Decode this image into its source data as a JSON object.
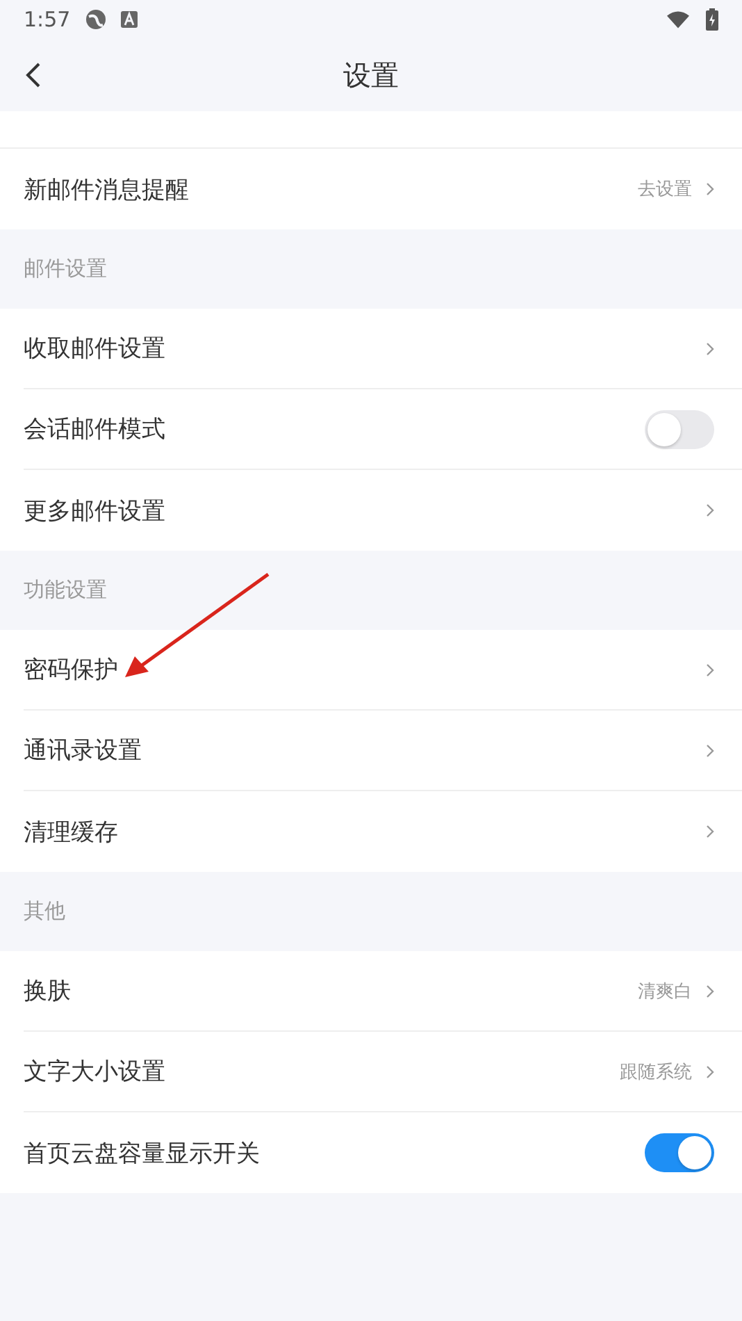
{
  "status_bar": {
    "time": "1:57"
  },
  "header": {
    "title": "设置"
  },
  "groups": [
    {
      "rows": [
        {
          "kind": "link",
          "label": "新邮件消息提醒",
          "value": "去设置"
        }
      ]
    },
    {
      "title": "邮件设置",
      "rows": [
        {
          "kind": "link",
          "label": "收取邮件设置"
        },
        {
          "kind": "toggle",
          "label": "会话邮件模式",
          "on": false
        },
        {
          "kind": "link",
          "label": "更多邮件设置"
        }
      ]
    },
    {
      "title": "功能设置",
      "rows": [
        {
          "kind": "link",
          "label": "密码保护"
        },
        {
          "kind": "link",
          "label": "通讯录设置"
        },
        {
          "kind": "link",
          "label": "清理缓存"
        }
      ]
    },
    {
      "title": "其他",
      "rows": [
        {
          "kind": "link",
          "label": "换肤",
          "value": "清爽白"
        },
        {
          "kind": "link",
          "label": "文字大小设置",
          "value": "跟随系统"
        },
        {
          "kind": "toggle",
          "label": "首页云盘容量显示开关",
          "on": true
        }
      ]
    }
  ]
}
